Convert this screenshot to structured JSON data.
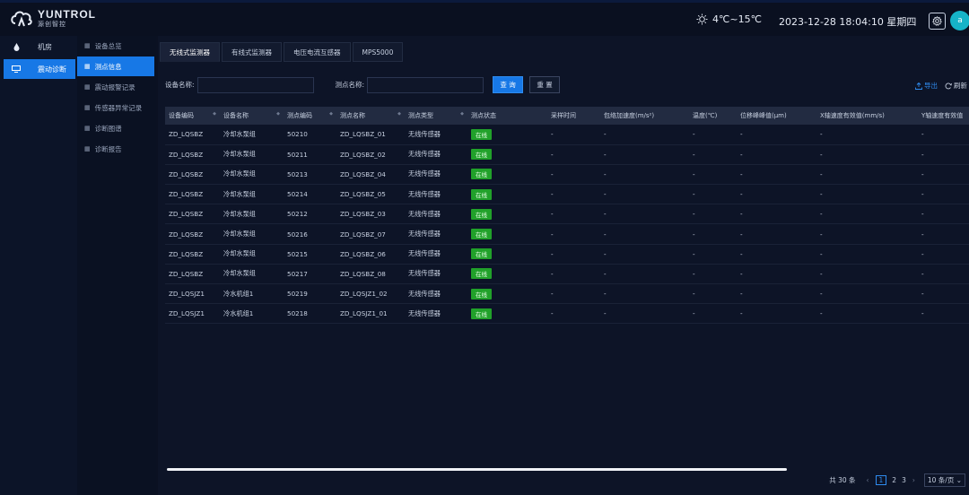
{
  "header": {
    "logo_name": "YUNTROL",
    "logo_sub": "源创智控",
    "weather": "4℃~15℃",
    "datetime": "2023-12-28 18:04:10 星期四",
    "avatar_letter": "a"
  },
  "sidebar_primary": {
    "items": [
      {
        "label": "机房",
        "icon": "droplet-icon"
      },
      {
        "label": "震动诊断",
        "icon": "monitor-icon"
      }
    ]
  },
  "sidebar_secondary": {
    "items": [
      {
        "label": "设备总览"
      },
      {
        "label": "测点信息"
      },
      {
        "label": "震动报警记录"
      },
      {
        "label": "传感器异常记录"
      },
      {
        "label": "诊断图谱"
      },
      {
        "label": "诊断报告"
      }
    ]
  },
  "tabs": [
    {
      "label": "无线式监测器"
    },
    {
      "label": "有线式监测器"
    },
    {
      "label": "电压电流互感器"
    },
    {
      "label": "MPS5000"
    }
  ],
  "filter": {
    "device_label": "设备名称:",
    "device_value": "",
    "point_label": "测点名称:",
    "point_value": "",
    "query": "查 询",
    "reset": "重 置"
  },
  "tools": {
    "export": "导出",
    "refresh": "刷新"
  },
  "table": {
    "columns": [
      "设备编码",
      "设备名称",
      "测点编码",
      "测点名称",
      "测点类型",
      "测点状态",
      "采样时间",
      "包络加速度(m/s²)",
      "温度(℃)",
      "位移峰峰值(μm)",
      "X轴速度有效值(mm/s)",
      "Y轴速度有效值"
    ],
    "rows": [
      [
        "ZD_LQSBZ",
        "冷却水泵组",
        "50210",
        "ZD_LQSBZ_01",
        "无线传感器",
        "在线",
        "-",
        "-",
        "-",
        "-",
        "-",
        "-"
      ],
      [
        "ZD_LQSBZ",
        "冷却水泵组",
        "50211",
        "ZD_LQSBZ_02",
        "无线传感器",
        "在线",
        "-",
        "-",
        "-",
        "-",
        "-",
        "-"
      ],
      [
        "ZD_LQSBZ",
        "冷却水泵组",
        "50213",
        "ZD_LQSBZ_04",
        "无线传感器",
        "在线",
        "-",
        "-",
        "-",
        "-",
        "-",
        "-"
      ],
      [
        "ZD_LQSBZ",
        "冷却水泵组",
        "50214",
        "ZD_LQSBZ_05",
        "无线传感器",
        "在线",
        "-",
        "-",
        "-",
        "-",
        "-",
        "-"
      ],
      [
        "ZD_LQSBZ",
        "冷却水泵组",
        "50212",
        "ZD_LQSBZ_03",
        "无线传感器",
        "在线",
        "-",
        "-",
        "-",
        "-",
        "-",
        "-"
      ],
      [
        "ZD_LQSBZ",
        "冷却水泵组",
        "50216",
        "ZD_LQSBZ_07",
        "无线传感器",
        "在线",
        "-",
        "-",
        "-",
        "-",
        "-",
        "-"
      ],
      [
        "ZD_LQSBZ",
        "冷却水泵组",
        "50215",
        "ZD_LQSBZ_06",
        "无线传感器",
        "在线",
        "-",
        "-",
        "-",
        "-",
        "-",
        "-"
      ],
      [
        "ZD_LQSBZ",
        "冷却水泵组",
        "50217",
        "ZD_LQSBZ_08",
        "无线传感器",
        "在线",
        "-",
        "-",
        "-",
        "-",
        "-",
        "-"
      ],
      [
        "ZD_LQSJZ1",
        "冷水机组1",
        "50219",
        "ZD_LQSJZ1_02",
        "无线传感器",
        "在线",
        "-",
        "-",
        "-",
        "-",
        "-",
        "-"
      ],
      [
        "ZD_LQSJZ1",
        "冷水机组1",
        "50218",
        "ZD_LQSJZ1_01",
        "无线传感器",
        "在线",
        "-",
        "-",
        "-",
        "-",
        "-",
        "-"
      ]
    ]
  },
  "pagination": {
    "total": "共 30 条",
    "pages": [
      "1",
      "2",
      "3"
    ],
    "current": "1",
    "page_size": "10 条/页"
  },
  "colors": {
    "accent": "#1778e6",
    "online": "#21a12a",
    "background": "#0b1122"
  }
}
